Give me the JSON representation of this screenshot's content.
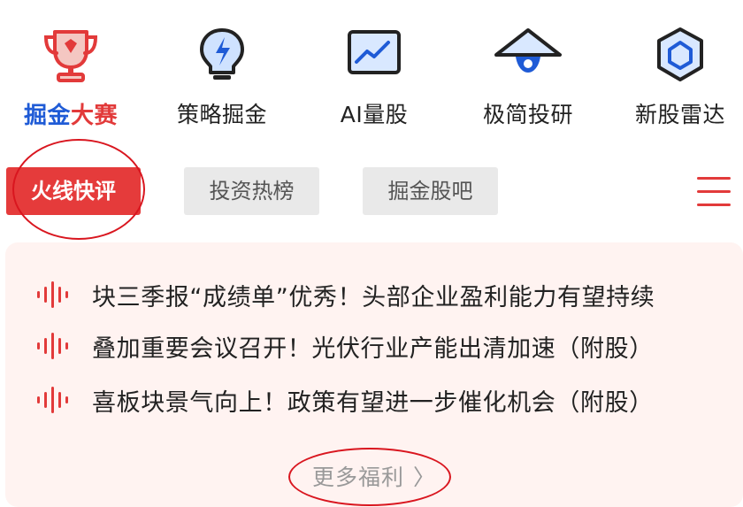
{
  "nav": {
    "items": [
      {
        "id": "contest",
        "label_part1": "掘金",
        "label_part2": "大赛",
        "icon": "trophy-icon"
      },
      {
        "id": "strategy",
        "label": "策略掘金",
        "icon": "lightbulb-icon"
      },
      {
        "id": "ai",
        "label": "AI量股",
        "icon": "chart-monitor-icon"
      },
      {
        "id": "research",
        "label": "极简投研",
        "icon": "eye-hat-icon"
      },
      {
        "id": "ipo",
        "label": "新股雷达",
        "icon": "hexagon-icon"
      }
    ]
  },
  "tabs": [
    {
      "label": "火线快评",
      "active": true
    },
    {
      "label": "投资热榜",
      "active": false
    },
    {
      "label": "掘金股吧",
      "active": false
    }
  ],
  "news": [
    {
      "text": "块三季报“成绩单”优秀！头部企业盈利能力有望持续",
      "icon": "audio-wave-icon"
    },
    {
      "text": "叠加重要会议召开！光伏行业产能出清加速（附股）",
      "icon": "audio-wave-icon"
    },
    {
      "text": "喜板块景气向上！政策有望进一步催化机会（附股）",
      "icon": "audio-wave-icon"
    }
  ],
  "more": {
    "label": "更多福利",
    "icon": "chevron-right-icon"
  },
  "colors": {
    "accent": "#e53b3b",
    "blue": "#1f5bd6",
    "card_bg": "#fff3f1",
    "annotation": "#d9161f"
  }
}
